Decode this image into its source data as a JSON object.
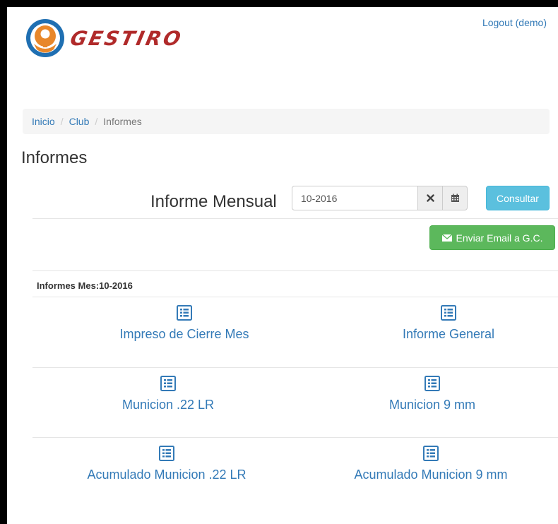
{
  "header": {
    "brand": "GESTIRO",
    "logout_label": "Logout (demo)"
  },
  "breadcrumb": {
    "items": [
      "Inicio",
      "Club"
    ],
    "active": "Informes",
    "separator": "/"
  },
  "page": {
    "title": "Informes"
  },
  "mensual": {
    "label": "Informe Mensual",
    "date_value": "10-2016",
    "clear_icon": "times-icon",
    "calendar_icon": "calendar-icon",
    "consultar_label": "Consultar"
  },
  "email": {
    "label": "Enviar Email a G.C.",
    "icon": "envelope-icon"
  },
  "reports": {
    "month_title": "Informes Mes:10-2016",
    "icon": "list-alt-icon",
    "items": [
      "Impreso de Cierre Mes",
      "Informe General",
      "Municion .22 LR",
      "Municion 9 mm",
      "Acumulado Municion .22 LR",
      "Acumulado Municion 9 mm"
    ]
  },
  "colors": {
    "link": "#337ab7",
    "info": "#5bc0de",
    "success": "#5cb85c",
    "brand": "#b02a2a",
    "logo_blue": "#1f6fb2",
    "logo_orange": "#e8872a"
  }
}
